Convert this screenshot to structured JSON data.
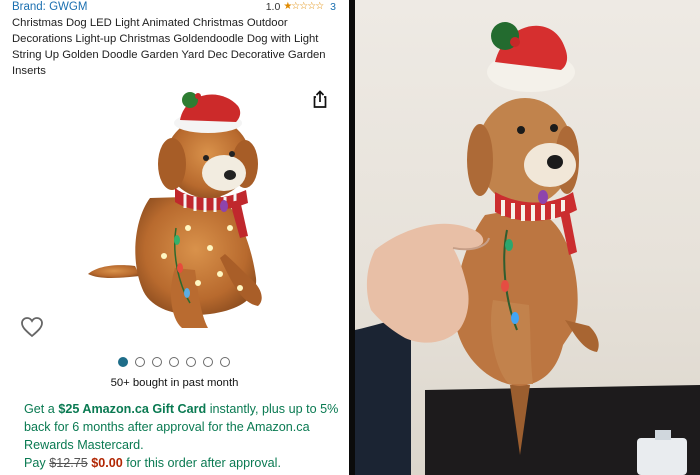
{
  "listing": {
    "brand": "Brand: GWGM",
    "rating_value": "1.0",
    "rating_stars": 1,
    "rating_count": "3",
    "title": "Christmas Dog LED Light Animated Christmas Outdoor Decorations Light-up Christmas Goldendoodle Dog with Light String Up Golden Doodle Garden Yard Dec Decorative Garden Inserts",
    "share_icon": "share-icon",
    "wishlist_icon": "heart-icon",
    "carousel": {
      "total": 7,
      "active_index": 0
    },
    "bought_text": "50+ bought in past month",
    "promo": {
      "prefix": "Get a ",
      "gift_card": "$25 Amazon.ca Gift Card",
      "middle": " instantly, plus up to 5% back for 6 months after approval for the Amazon.ca Rewards Mastercard.",
      "pay_prefix": "Pay ",
      "old_price": "$12.75",
      "new_price": "$0.00",
      "pay_suffix": " for this order after approval."
    }
  },
  "colors": {
    "link": "#1a6fb0",
    "promo_green": "#0a7a52",
    "price_red": "#b12704",
    "star_orange": "#e08a00",
    "carousel_active": "#1e6d89"
  }
}
